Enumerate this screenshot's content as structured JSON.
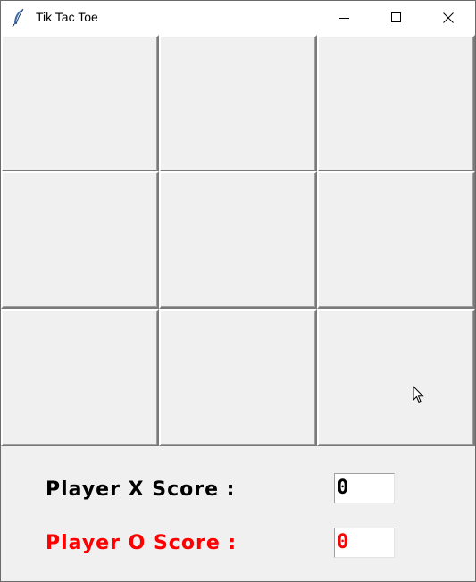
{
  "window": {
    "title": "Tik Tac Toe",
    "app_icon": "feather-icon",
    "controls": [
      "minimize-icon",
      "maximize-icon",
      "close-icon"
    ]
  },
  "board": {
    "cells": [
      [
        "",
        "",
        ""
      ],
      [
        "",
        "",
        ""
      ],
      [
        "",
        "",
        ""
      ]
    ]
  },
  "scores": {
    "player_x_label": "Player X Score :",
    "player_x_value": "0",
    "player_o_label": "Player O Score :",
    "player_o_value": "0"
  },
  "colors": {
    "player_x": "#000000",
    "player_o": "#ff0000",
    "background": "#f0f0f0"
  }
}
